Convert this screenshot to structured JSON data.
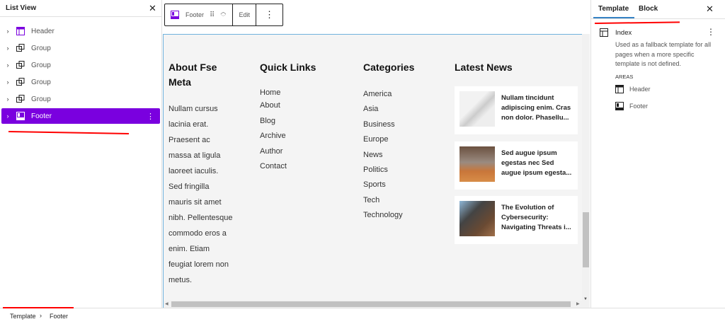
{
  "list_view": {
    "title": "List View",
    "items": [
      {
        "label": "Header",
        "icon": "header-template-part-icon"
      },
      {
        "label": "Group",
        "icon": "group-icon"
      },
      {
        "label": "Group",
        "icon": "group-icon"
      },
      {
        "label": "Group",
        "icon": "group-icon"
      },
      {
        "label": "Group",
        "icon": "group-icon"
      },
      {
        "label": "Footer",
        "icon": "footer-template-part-icon",
        "selected": true
      }
    ]
  },
  "block_toolbar": {
    "block": "Footer",
    "edit": "Edit"
  },
  "footer": {
    "about": {
      "heading_line1": "About Fse",
      "heading_line2": "Meta",
      "lines": [
        "Nullam cursus",
        "lacinia erat.",
        "Praesent ac",
        "massa at ligula",
        "laoreet iaculis.",
        "Sed fringilla",
        "mauris sit amet",
        "nibh. Pellentesque",
        "commodo eros a",
        "enim. Etiam",
        "feugiat lorem non",
        "metus."
      ]
    },
    "quick_links": {
      "heading": "Quick Links",
      "items": [
        "Home",
        "About",
        "Blog",
        "Archive",
        "Author",
        "Contact"
      ]
    },
    "categories": {
      "heading": "Categories",
      "items": [
        "America",
        "Asia",
        "Business",
        "Europe",
        "News",
        "Politics",
        "Sports",
        "Tech",
        "Technology"
      ]
    },
    "latest_news": {
      "heading": "Latest News",
      "posts": [
        {
          "title": "Nullam tincidunt adipiscing enim. Cras non dolor. Phasellu..."
        },
        {
          "title": "Sed augue ipsum egestas nec Sed augue ipsum egesta..."
        },
        {
          "title": "The Evolution of Cybersecurity: Navigating Threats i..."
        }
      ]
    }
  },
  "sidebar": {
    "tabs": [
      "Template",
      "Block"
    ],
    "active_tab": "Template",
    "template_name": "Index",
    "description": "Used as a fallback template for all pages when a more specific template is not defined.",
    "areas_label": "AREAS",
    "areas": [
      "Header",
      "Footer"
    ]
  },
  "breadcrumb": [
    "Template",
    "Footer"
  ],
  "colors": {
    "accent": "#7a00df",
    "annotation": "#ff0000",
    "canvas_border": "#6fb2dc"
  }
}
